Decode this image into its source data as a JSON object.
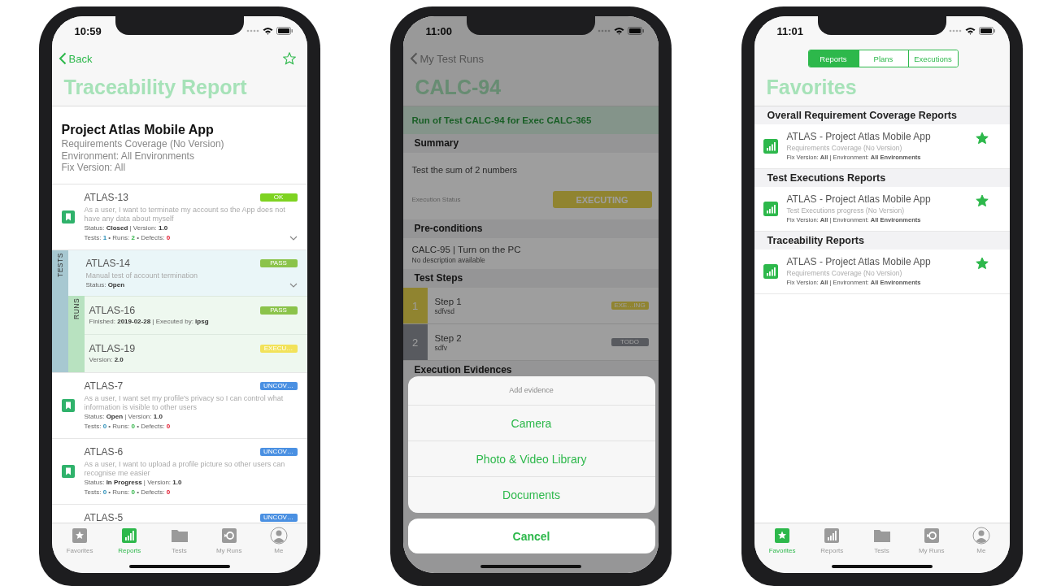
{
  "phones": [
    {
      "kind": "traceability",
      "time": "10:59",
      "back": "Back",
      "favorited": false,
      "title": "Traceability Report",
      "project": {
        "name": "Project Atlas Mobile App",
        "lines": [
          "Requirements Coverage (No Version)",
          "Environment: All Environments",
          "Fix Version: All"
        ]
      },
      "requirements": [
        {
          "id": "ATLAS-13",
          "badge": "OK",
          "color": "#7ed321",
          "description": "As a user, I want to terminate my account so the App does not have any data about myself",
          "status": "Status: **Closed** | Version: **1.0**",
          "separator": "•",
          "counts": [
            {
              "label": "Tests:",
              "value": "1"
            },
            {
              "label": "Runs:",
              "value": "2"
            },
            {
              "label": "Defects:",
              "value": "0"
            }
          ],
          "expanded": true,
          "tests_label": "TESTS",
          "tests": [
            {
              "id": "ATLAS-14",
              "badge": "PASS",
              "color": "#8bc34a",
              "description": "Manual test of account termination",
              "status": "Status: **Open**",
              "expanded": true,
              "runs_label": "RUNS",
              "runs": [
                {
                  "id": "ATLAS-16",
                  "badge": "PASS",
                  "color": "#8bc34a",
                  "detail": "Finished: **2019-02-28** | Executed by: **lpsg**"
                },
                {
                  "id": "ATLAS-19",
                  "badge": "EXECU…",
                  "color": "#f2e25a",
                  "detail": "Version: **2.0**"
                }
              ]
            }
          ]
        },
        {
          "id": "ATLAS-7",
          "badge": "UNCOV…",
          "color": "#4a90e2",
          "description": "As a user, I want set my profile's privacy so I can control what information is visible to other users",
          "status": "Status: **Open** | Version: **1.0**",
          "separator": "•",
          "counts": [
            {
              "label": "Tests:",
              "value": "0"
            },
            {
              "label": "Runs:",
              "value": "0"
            },
            {
              "label": "Defects:",
              "value": "0"
            }
          ]
        },
        {
          "id": "ATLAS-6",
          "badge": "UNCOV…",
          "color": "#4a90e2",
          "description": "As a user, I want to upload a profile picture so other users can recognise me easier",
          "status": "Status: **In Progress** | Version: **1.0**",
          "separator": "•",
          "counts": [
            {
              "label": "Tests:",
              "value": "0"
            },
            {
              "label": "Runs:",
              "value": "0"
            },
            {
              "label": "Defects:",
              "value": "0"
            }
          ]
        },
        {
          "id": "ATLAS-5",
          "badge": "UNCOV…",
          "color": "#4a90e2"
        }
      ],
      "tab_bar": [
        {
          "label": "Favorites",
          "kind": "star",
          "selected": false
        },
        {
          "label": "Reports",
          "kind": "chart",
          "selected": true
        },
        {
          "label": "Tests",
          "kind": "folder",
          "selected": false
        },
        {
          "label": "My Runs",
          "kind": "runs",
          "selected": false
        },
        {
          "label": "Me",
          "kind": "person",
          "selected": false
        }
      ]
    },
    {
      "kind": "test_run",
      "time": "11:00",
      "back": "My Test Runs",
      "title": "CALC-94",
      "banner": "Run of Test CALC-94 for Exec CALC-365",
      "summary": {
        "header": "Summary",
        "text": "Test the sum of 2 numbers",
        "status_label": "Execution Status",
        "status": "EXECUTING",
        "kind": "executing"
      },
      "preconditions": {
        "header": "Pre-conditions",
        "title": "CALC-95 | Turn on the PC",
        "description": "No description available"
      },
      "steps_header": "Test Steps",
      "steps": [
        {
          "number": "1",
          "name": "Step 1",
          "detail": "sdfvsd",
          "status": "EXE…ING",
          "kind": "executing"
        },
        {
          "number": "2",
          "name": "Step 2",
          "detail": "sdfv",
          "status": "TODO",
          "kind": "todo"
        }
      ],
      "evidences_header": "Execution Evidences",
      "action_sheet": {
        "title": "Add evidence",
        "options": [
          "Camera",
          "Photo & Video Library",
          "Documents"
        ],
        "cancel": "Cancel"
      }
    },
    {
      "kind": "favorites",
      "time": "11:01",
      "segments": [
        {
          "label": "Reports",
          "selected": true
        },
        {
          "label": "Plans",
          "selected": false
        },
        {
          "label": "Executions",
          "selected": false
        }
      ],
      "title": "Favorites",
      "sections": [
        {
          "title": "Overall Requirement Coverage Reports",
          "items": [
            {
              "name": "ATLAS - Project Atlas Mobile App",
              "subtitle": "Requirements Coverage (No Version)",
              "details": "Fix Version: **All** | Environment: **All Environments**",
              "favorite": true
            }
          ]
        },
        {
          "title": "Test Executions Reports",
          "items": [
            {
              "name": "ATLAS - Project Atlas Mobile App",
              "subtitle": "Test Executions progress (No Version)",
              "details": "Fix Version: **All** | Environment: **All Environments**",
              "favorite": true
            }
          ]
        },
        {
          "title": "Traceability Reports",
          "items": [
            {
              "name": "ATLAS - Project Atlas Mobile App",
              "subtitle": "Requirements Coverage (No Version)",
              "details": "Fix Version: **All** | Environment: **All Environments**",
              "favorite": true
            }
          ]
        }
      ],
      "tab_bar": [
        {
          "label": "Favorites",
          "kind": "star",
          "selected": true
        },
        {
          "label": "Reports",
          "kind": "chart",
          "selected": false
        },
        {
          "label": "Tests",
          "kind": "folder",
          "selected": false
        },
        {
          "label": "My Runs",
          "kind": "runs",
          "selected": false
        },
        {
          "label": "Me",
          "kind": "person",
          "selected": false
        }
      ]
    }
  ]
}
